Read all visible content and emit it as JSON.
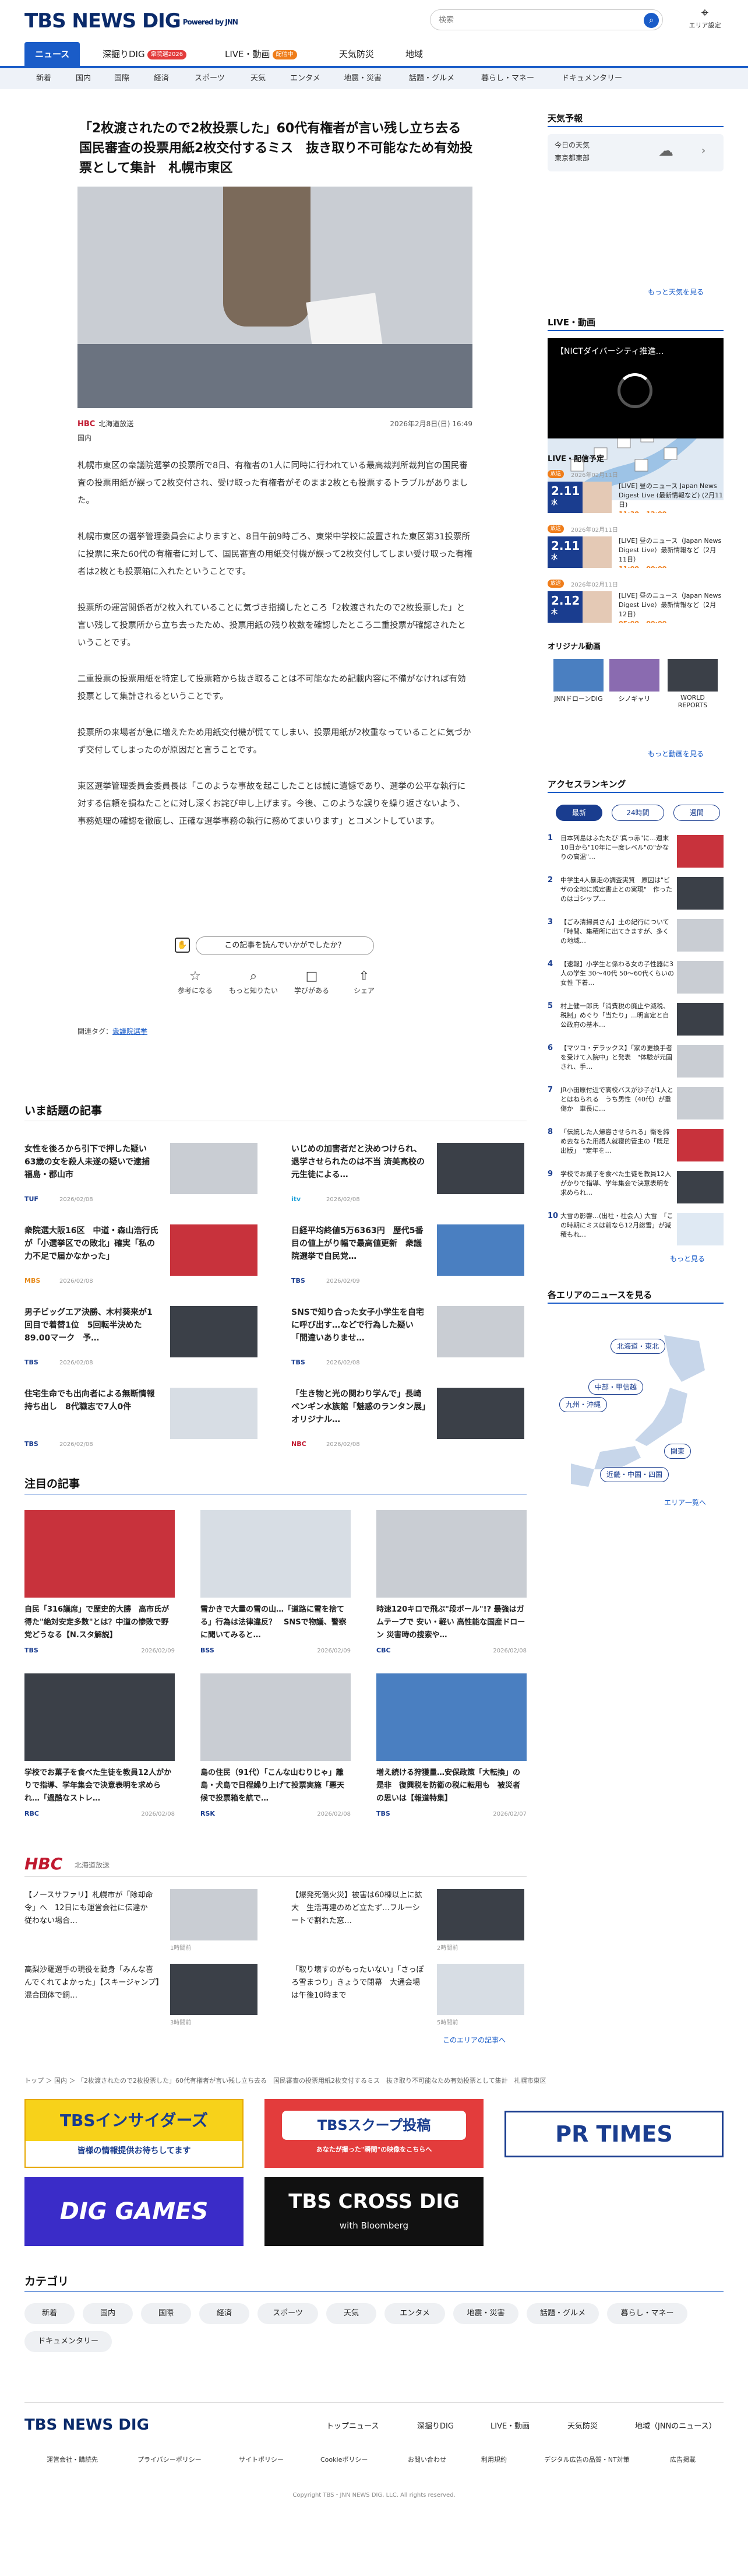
{
  "header": {
    "logo_text": "TBS NEWS DIG",
    "logo_sub": "Powered by JNN",
    "search_placeholder": "検索",
    "area_label": "エリア設定"
  },
  "nav_main": [
    {
      "label": "ニュース"
    },
    {
      "label": "深掘りDIG",
      "badge": "衆院選2026"
    },
    {
      "label": "LIVE・動画",
      "badge": "配信中"
    },
    {
      "label": "天気防災"
    },
    {
      "label": "地域"
    }
  ],
  "nav_sub": [
    "新着",
    "国内",
    "国際",
    "経済",
    "スポーツ",
    "天気",
    "エンタメ",
    "地震・災害",
    "話題・グルメ",
    "暮らし・マネー",
    "ドキュメンタリー"
  ],
  "article": {
    "title": "「2枚渡されたので2枚投票した」60代有権者が言い残し立ち去る　国民審査の投票用紙2枚交付するミス　抜き取り不可能なため有効投票として集計　札幌市東区",
    "source": "北海道放送",
    "source_logo": "HBC",
    "date": "2026年2月8日(日) 16:49",
    "category": "国内",
    "paragraphs": [
      "札幌市東区の衆議院選挙の投票所で8日、有権者の1人に同時に行われている最高裁判所裁判官の国民審査の投票用紙が誤って2枚交付され、受け取った有権者がそのまま2枚とも投票するトラブルがありました。",
      "札幌市東区の選挙管理委員会によりますと、8日午前9時ごろ、東栄中学校に設置された東区第31投票所に投票に来た60代の有権者に対して、国民審査の用紙交付機が誤って2枚交付してしまい受け取った有権者は2枚とも投票箱に入れたということです。",
      "投票所の運営関係者が2枚入れていることに気づき指摘したところ「2枚渡されたので2枚投票した」と言い残して投票所から立ち去ったため、投票用紙の残り枚数を確認したところ二重投票が確認されたということです。",
      "二重投票の投票用紙を特定して投票箱から抜き取ることは不可能なため記載内容に不備がなければ有効投票として集計されるということです。",
      "投票所の来場者が急に増えたため用紙交付機が慌ててしまい、投票用紙が2枚重なっていることに気づかず交付してしまったのが原因だと言うことです。",
      "東区選挙管理委員会委員長は「このような事故を起こしたことは誠に遺憾であり、選挙の公平な執行に対する信頼を損ねたことに対し深くお詫び申し上げます。今後、このような誤りを繰り返さないよう、事務処理の確認を徹底し、正確な選挙事務の執行に務めてまいります」とコメントしています。"
    ],
    "reaction_question": "この記事を読んでいかがでしたか？",
    "reactions": [
      "参考になる",
      "もっと知りたい",
      "学びがある",
      "シェア"
    ],
    "tags_label": "関連タグ：",
    "tag": "衆議院選挙"
  },
  "trending": {
    "heading": "いま話題の記事",
    "items": [
      {
        "title": "女性を後ろから引下で押した疑い　63歳の女を殺人未遂の疑いで逮捕　福島・郡山市",
        "source": "TUF",
        "date": "2026/02/08",
        "scolor": "#1a3d8f"
      },
      {
        "title": "いじめの加害者だと決めつけられ、退学させられたのは不当 済美高校の元生徒による…",
        "source": "itv",
        "date": "2026/02/08",
        "scolor": "#1a9fd8"
      },
      {
        "title": "衆院選大阪16区　中道・森山浩行氏が「小選挙区での敗北」確実「私の力不足で届かなかった」",
        "source": "MBS",
        "date": "2026/02/08",
        "scolor": "#e68a1a"
      },
      {
        "title": "日経平均終値5万6363円　歴代5番目の値上がり幅で最高値更新　衆議院選挙で自民党…",
        "source": "TBS",
        "date": "2026/02/09",
        "scolor": "#1a3d8f"
      },
      {
        "title": "男子ビッグエア決勝、木村葵来が1回目で着替1位　5回転半決めた89.00マーク　予…",
        "source": "TBS",
        "date": "2026/02/08",
        "scolor": "#1a3d8f"
      },
      {
        "title": "SNSで知り合った女子小学生を自宅に呼び出す…などで行為した疑い「間違いありませ…",
        "source": "TBS",
        "date": "2026/02/08",
        "scolor": "#1a3d8f"
      },
      {
        "title": "住宅生命でも出向者による無断情報持ち出し　8代職志で7人0件",
        "source": "TBS",
        "date": "2026/02/08",
        "scolor": "#1a3d8f"
      },
      {
        "title": "「生き物と光の関わり学んで」長崎ペンギン水族館「魅惑のランタン展」オリジナル…",
        "source": "NBC",
        "date": "2026/02/08",
        "scolor": "#c0182f"
      }
    ]
  },
  "featured": {
    "heading": "注目の記事",
    "items": [
      {
        "title": "自民「316議席」で歴史的大勝　高市氏が得た\"絶対安定多数\"とは？中道の惨敗で野党どうなる【N.スタ解説】",
        "source": "TBS",
        "date": "2026/02/09"
      },
      {
        "title": "雪かきで大量の雪の山…「道路に雪を捨てる」行為は法律違反？　SNSで物議、警察に聞いてみると…",
        "source": "BSS",
        "date": "2026/02/09"
      },
      {
        "title": "時速120キロで飛ぶ\"段ボール\"!? 最強はガムテープで 安い・軽い 高性能な国産ドローン 災害時の搜索や…",
        "source": "CBC",
        "date": "2026/02/08"
      },
      {
        "title": "学校でお菓子を食べた生徒を教員12人がかりで指導、学年集会で決意表明を求められ…「過酷なストレ…",
        "source": "RBC",
        "date": "2026/02/08"
      },
      {
        "title": "島の住民（91代）「こんな山むりじゃ」離島・犬島で日程繰り上げて投票実施「悪天候で投票箱を航で…",
        "source": "RSK",
        "date": "2026/02/08"
      },
      {
        "title": "増え続ける狩獲量…安保政策「大転換」の是非　復興税を防衛の税に転用も　被災者の思いは【報道特集】",
        "source": "TBS",
        "date": "2026/02/07"
      }
    ]
  },
  "hbc": {
    "logo": "HBC",
    "label": "北海道放送",
    "items": [
      {
        "title": "【ノースサファリ】札幌市が「除却命令」へ　12日にも運営会社に伝達か　従わない場合…",
        "date": "1時間前"
      },
      {
        "title": "【爆発死傷火災】被害は60棟以上に拡大　生活再建のめど立たず…フルーシートで割れた窓…",
        "date": "2時間前"
      },
      {
        "title": "高梨沙羅選手の現役を動身「みんな喜んでくれてよかった」【スキージャンプ】混合団体で銅…",
        "date": "3時間前"
      },
      {
        "title": "「取り壊すのがもったいない」「さっぽろ雪まつり」きょうで閉幕　大通会場は午後10時まで",
        "date": "5時間前"
      }
    ],
    "more": "このエリアの記事へ"
  },
  "breadcrumb": "トップ ＞ 国内 ＞ 「2枚渡されたので2枚投票した」60代有権者が言い残し立ち去る　国民審査の投票用紙2枚交付するミス　抜き取り不可能なため有効投票として集計　札幌市東区",
  "banners": [
    {
      "title": "TBSインサイダーズ",
      "sub": "皆様の情報提供お待ちしてます"
    },
    {
      "title": "TBSスクープ投稿",
      "sub": "あなたが撮った\"瞬間\"の映像をこちらへ"
    },
    {
      "title": "PR TIMES",
      "sub": ""
    },
    {
      "title": "DIG GAMES",
      "sub": ""
    },
    {
      "title": "TBS CROSS DIG",
      "sub": "with Bloomberg"
    }
  ],
  "category": {
    "heading": "カテゴリ",
    "items": [
      "新着",
      "国内",
      "国際",
      "経済",
      "スポーツ",
      "天気",
      "エンタメ",
      "地震・災害",
      "話題・グルメ",
      "暮らし・マネー",
      "ドキュメンタリー"
    ]
  },
  "footer": {
    "logo": "TBS NEWS DIG",
    "nav": [
      "トップニュース",
      "深掘りDIG",
      "LIVE・動画",
      "天気防災",
      "地域（JNNのニュース）"
    ],
    "links": [
      "運営会社・購読先",
      "プライバシーポリシー",
      "サイトポリシー",
      "Cookieポリシー",
      "お問い合わせ",
      "利用規約",
      "デジタル広告の品質・NT対策",
      "広告掲載"
    ],
    "copyright": "Copyright TBS・JNN NEWS DIG, LLC. All rights reserved."
  },
  "sidebar": {
    "weather": {
      "heading": "天気予報",
      "l1": "今日の天気",
      "l2": "東京都東部",
      "more": "もっと天気を見る"
    },
    "live": {
      "heading": "LIVE・動画",
      "title": "【NICTダイバーシティ推進…"
    },
    "schedule": {
      "heading": "LIVE・配信予定",
      "items": [
        {
          "tag": "放送",
          "date": "2026年02月11日",
          "day": "2.11",
          "wd": "水",
          "time": "11:30 - 12:00",
          "text": "[LIVE] 昼のニュース Japan News Digest Live (最新情報など) (2月11日)"
        },
        {
          "tag": "放送",
          "date": "2026年02月11日",
          "day": "2.11",
          "wd": "水",
          "time": "11:00 - 00:00",
          "text": "[LIVE] 昼のニュース（Japan News Digest Live）最新情報など（2月11日）"
        },
        {
          "tag": "放送",
          "date": "2026年02月11日",
          "day": "2.12",
          "wd": "木",
          "time": "05:00 - 00:00",
          "text": "[LIVE] 昼のニュース（Japan News Digest Live）最新情報など（2月12日）"
        }
      ]
    },
    "programs": {
      "heading": "オリジナル動画",
      "items": [
        "JNNドローンDIG",
        "シノギャリ",
        "WORLD REPORTS"
      ],
      "more": "もっと動画を見る"
    },
    "ranking": {
      "heading": "アクセスランキング",
      "tabs": [
        "最新",
        "24時間",
        "週間"
      ],
      "items": [
        "日本列島はふたたび\"真っ赤\"に…週末10日から\"10年に一度レベル\"の\"かなりの高温\"…",
        "中学生4人暴走の調査実質　原因は\"ビザの全地に規定書止との実現\"　作ったのはゴシップ…",
        "【ごみ清掃員さん】土の紀行について「時間、集積所に出てきますが、多くの地域…",
        "【速報】小学生と係わる女の子性器に3人の学生 30〜40代 50〜60代くらいの女性 下着…",
        "村上健一郎氏「消費税の廃止や減税、税制」めぐり「当たり」...明言定と自公政府の基本…",
        "【マツコ・デラックス】「家の更換手者を受けて入院中」と発表　\"体験が元固され、手…",
        "JR小田原付近で高校バスが沙子が1人ととはねられる　うち男性（40代）が重傷か　車長に…",
        "「伝統した人帰容させられる」衛を締め去ならた用語人就寝的管主の「既足出版」　\"定年を…",
        "学校でお菓子を食べた生徒を教員12人がかりで指導、学年集会で決意表明を求められ…",
        "大雪の影響…(出社・社会人) 大雪　「この時期にミスは前なら12月総雪」が減積もれ…"
      ],
      "more": "もっと見る"
    },
    "area": {
      "heading": "各エリアのニュースを見る",
      "buttons": [
        "北海道・東北",
        "中部・甲信越",
        "九州・沖縄",
        "関東",
        "近畿・中国・四国"
      ],
      "more": "エリア一覧へ"
    }
  },
  "colors": {
    "brand": "#1a5cc8",
    "navy": "#0a2a6a",
    "hbc_red": "#c0182f"
  }
}
